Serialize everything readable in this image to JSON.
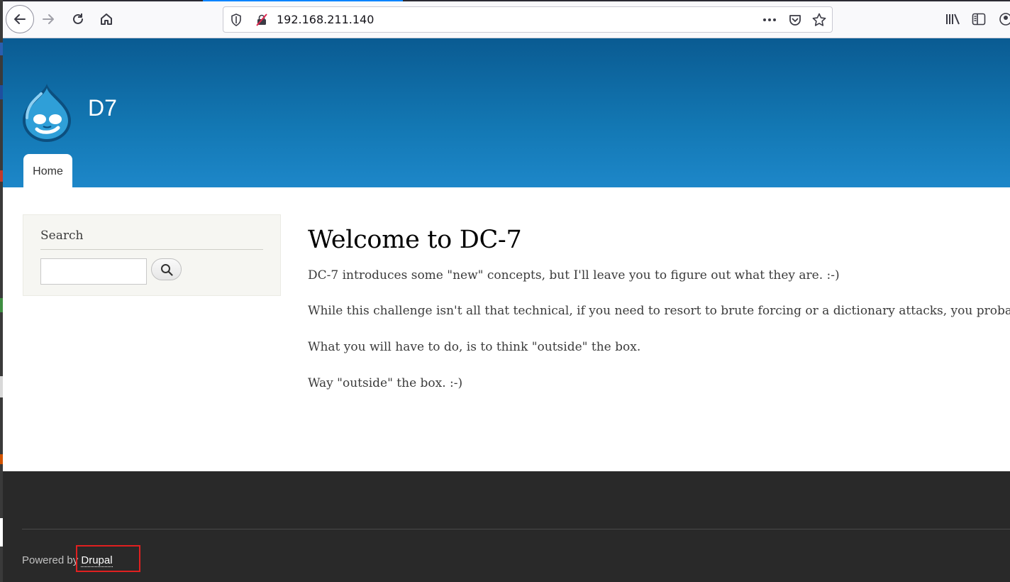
{
  "browser": {
    "url": "192.168.211.140",
    "icons": {
      "back": "back-arrow-icon",
      "forward": "forward-arrow-icon",
      "reload": "reload-icon",
      "home": "home-icon",
      "shield": "shield-icon",
      "insecure": "insecure-connection-icon",
      "page_actions": "more-horizontal-icon",
      "pocket": "pocket-icon",
      "bookmark": "star-icon",
      "library": "library-icon",
      "sidebar": "sidebar-icon",
      "account": "account-icon"
    }
  },
  "header": {
    "site_name": "D7",
    "nav": [
      {
        "label": "Home"
      }
    ],
    "colors": {
      "gradient_top": "#0a5b92",
      "gradient_bottom": "#1d87c9"
    }
  },
  "sidebar": {
    "search": {
      "title": "Search",
      "value": ""
    }
  },
  "main": {
    "title": "Welcome to DC-7",
    "paragraphs": [
      "DC-7 introduces some \"new\" concepts, but I'll leave you to figure out what they are.  :-)",
      "While this challenge isn't all that technical, if you need to resort to brute forcing or a dictionary attacks, you probably wo",
      "What you will have to do, is to think \"outside\" the box.",
      "Way \"outside\" the box.  :-)"
    ]
  },
  "footer": {
    "powered_by": "Powered by ",
    "link": "Drupal",
    "highlight_color": "#e02020"
  }
}
